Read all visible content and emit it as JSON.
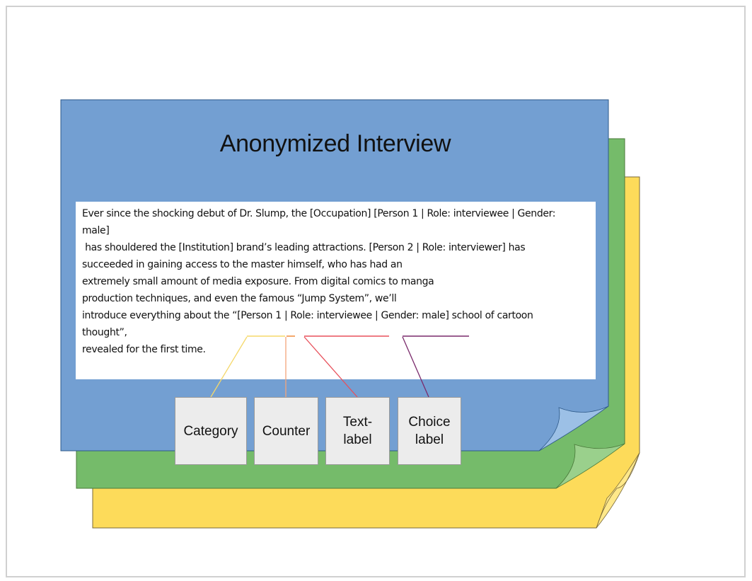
{
  "title": "Anonymized Interview",
  "text_lines": [
    "Ever since the shocking debut of Dr. Slump, the [Occupation] [Person 1 | Role: interviewee | Gender:",
    "male]",
    " has shouldered the [Institution] brand’s leading attractions. [Person 2 | Role: interviewer] has",
    "succeeded in gaining access to the master himself, who has had an",
    "extremely small amount of media exposure. From digital comics to manga",
    "production techniques, and even the famous “Jump System”, we’ll",
    "introduce everything about the “[Person 1 | Role: interviewee | Gender: male] school of cartoon",
    "thought”,",
    "revealed for the first time."
  ],
  "labels": [
    {
      "text": "Category",
      "color": "#f5d86a"
    },
    {
      "text": "Counter",
      "color": "#f4a57a"
    },
    {
      "text": "Text-\nlabel",
      "color": "#e8505b"
    },
    {
      "text": "Choice\nlabel",
      "color": "#7a2a6b"
    }
  ],
  "colors": {
    "blue_sheet": "#739fd2",
    "green_sheet": "#75bb6a",
    "yellow_sheet": "#fddb5a",
    "sheet_border": "#2e5a8a"
  }
}
